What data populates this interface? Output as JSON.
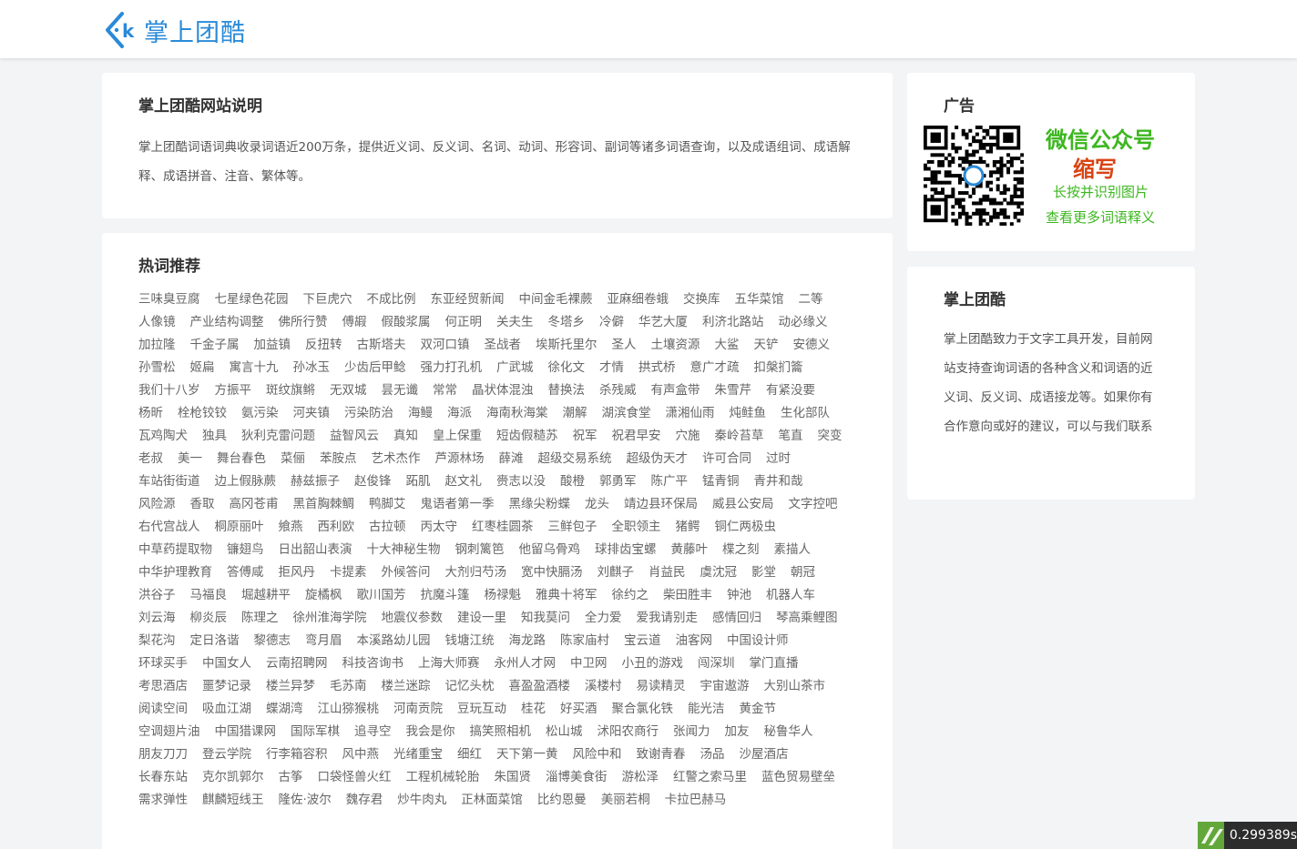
{
  "header": {
    "logo_text": "掌上团酷"
  },
  "intro": {
    "title": "掌上团酷网站说明",
    "text": "掌上团酷词语词典收录词语近200万条，提供近义词、反义词、名词、动词、形容词、副词等诸多词语查询，以及成语组词、成语解释、成语拼音、注音、繁体等。"
  },
  "hot": {
    "title": "热词推荐",
    "words": [
      "三味臭豆腐",
      "七星绿色花园",
      "下巨虎穴",
      "不成比例",
      "东亚经贸新闻",
      "中间金毛裸蕨",
      "亚麻细卷蛾",
      "交换库",
      "五华菜馆",
      "二等",
      "人像镜",
      "产业结构调整",
      "佛所行赞",
      "傅嘏",
      "假酸浆属",
      "何正明",
      "关夫生",
      "冬塔乡",
      "冷僻",
      "华艺大厦",
      "利济北路站",
      "动必缘义",
      "加拉隆",
      "千金子属",
      "加益镇",
      "反扭转",
      "古斯塔夫",
      "双河口镇",
      "圣战者",
      "埃斯托里尔",
      "圣人",
      "土壤资源",
      "大鲨",
      "天铲",
      "安德义",
      "孙雪松",
      "姬扁",
      "寓言十九",
      "孙冰玉",
      "少齿后甲鲶",
      "强力打孔机",
      "广武城",
      "徐化文",
      "才情",
      "拱式桥",
      "意广才疏",
      "扣槃扪籥",
      "我们十八岁",
      "方振平",
      "斑纹旗鳉",
      "无双城",
      "昙无谶",
      "常常",
      "晶状体混浊",
      "替换法",
      "杀残威",
      "有声盒带",
      "朱雪芹",
      "有紧没要",
      "杨昕",
      "栓枪铰铰",
      "氨污染",
      "河夹镇",
      "污染防治",
      "海鳗",
      "海派",
      "海南秋海棠",
      "潮解",
      "湖滨食堂",
      "潇湘仙雨",
      "炖鲑鱼",
      "生化部队",
      "瓦鸡陶犬",
      "独具",
      "狄利克雷问题",
      "益智风云",
      "真知",
      "皇上保重",
      "短齿假糙苏",
      "祝军",
      "祝君早安",
      "穴施",
      "秦岭苔草",
      "笔直",
      "突变",
      "老叔",
      "美一",
      "舞台春色",
      "菜俪",
      "苯胺点",
      "艺术杰作",
      "芦源林场",
      "薛滩",
      "超级交易系统",
      "超级伪天才",
      "许可合同",
      "过时",
      "车站街街道",
      "边上假脉蕨",
      "赫兹振子",
      "赵俊锋",
      "跖肌",
      "赵文礼",
      "赍志以没",
      "酸橙",
      "郭勇军",
      "陈广平",
      "锰青铜",
      "青井和哉",
      "风险源",
      "香取",
      "高冈苍甫",
      "黑首胸棘鲷",
      "鸭脚艾",
      "鬼语者第一季",
      "黑缘尖粉蝶",
      "龙头",
      "靖边县环保局",
      "威县公安局",
      "文字控吧",
      "右代宫战人",
      "桐原丽叶",
      "飨燕",
      "西利欧",
      "古拉顿",
      "丙太守",
      "红枣桂圆茶",
      "三鲜包子",
      "全职领主",
      "猪鳄",
      "铜仁两极虫",
      "中草药提取物",
      "镰翅鸟",
      "日出韶山表演",
      "十大神秘生物",
      "钢刺篱笆",
      "他留乌骨鸡",
      "球排齿宝螺",
      "黄藤叶",
      "楪之刻",
      "素描人",
      "中华护理教育",
      "答傅咸",
      "拒风丹",
      "卡提素",
      "外候答问",
      "大剂归芍汤",
      "宽中快膈汤",
      "刘麒子",
      "肖益民",
      "虞沈冠",
      "影堂",
      "朝冠",
      "洪谷子",
      "马福良",
      "堀越耕平",
      "旋橘枫",
      "歌川国芳",
      "抗魔斗篷",
      "杨禄魁",
      "雅典十将军",
      "徐约之",
      "柴田胜丰",
      "钟池",
      "机器人车",
      "刘云海",
      "柳炎辰",
      "陈理之",
      "徐州淮海学院",
      "地震仪参数",
      "建设一里",
      "知我莫问",
      "全力爱",
      "爱我请别走",
      "感情回归",
      "琴高乘鲤图",
      "梨花沟",
      "定日洛谐",
      "黎德志",
      "弯月眉",
      "本溪路幼儿园",
      "钱塘江统",
      "海龙路",
      "陈家庙村",
      "宝云道",
      "油客网",
      "中国设计师",
      "环球买手",
      "中国女人",
      "云南招聘网",
      "科技咨询书",
      "上海大师赛",
      "永州人才网",
      "中卫网",
      "小丑的游戏",
      "闯深圳",
      "掌门直播",
      "考思酒店",
      "噩梦记录",
      "楼兰异梦",
      "毛苏南",
      "楼兰迷踪",
      "记忆头枕",
      "喜盈盈酒楼",
      "溪楼村",
      "易读精灵",
      "宇宙遨游",
      "大别山茶市",
      "阅读空间",
      "吸血江湖",
      "蝶湖湾",
      "江山猕猴桃",
      "河南贡院",
      "豆玩互动",
      "桂花",
      "好买酒",
      "聚合氯化铁",
      "能光洁",
      "黄金节",
      "空调翅片油",
      "中国猎课网",
      "国际军棋",
      "追寻空",
      "我会是你",
      "搞笑照相机",
      "松山城",
      "沭阳农商行",
      "张闻力",
      "加友",
      "秘鲁华人",
      "朋友刀刀",
      "登云学院",
      "行李箱容积",
      "风中燕",
      "光绪重宝",
      "细红",
      "天下第一黄",
      "风险中和",
      "致谢青春",
      "汤品",
      "沙屋酒店",
      "长春东站",
      "克尔凯郭尔",
      "古筝",
      "口袋怪兽火红",
      "工程机械轮胎",
      "朱国贤",
      "淄博美食街",
      "游松泽",
      "红警之索马里",
      "蓝色贸易壁垒",
      "需求弹性",
      "麒麟短线王",
      "隆佐·波尔",
      "魏存君",
      "炒牛肉丸",
      "正林面菜馆",
      "比约恩曼",
      "美丽若桐",
      "卡拉巴赫马"
    ]
  },
  "ad": {
    "title": "广告",
    "wx_title": "微信公众号",
    "wx_sub": "缩写",
    "line1": "长按并识别图片",
    "line2": "查看更多词语释义"
  },
  "about": {
    "title": "掌上团酷",
    "text": "掌上团酷致力于文字工具开发，目前网站支持查询词语的各种含义和词语的近义词、反义词、成语接龙等。如果你有合作意向或好的建议，可以与我们联系"
  },
  "timer": {
    "value": "0.299389s"
  },
  "colors": {
    "brand": "#2a8ad8",
    "wechat_green": "#3cb71f",
    "accent_red": "#d94414",
    "timer_green": "#63a73b"
  }
}
